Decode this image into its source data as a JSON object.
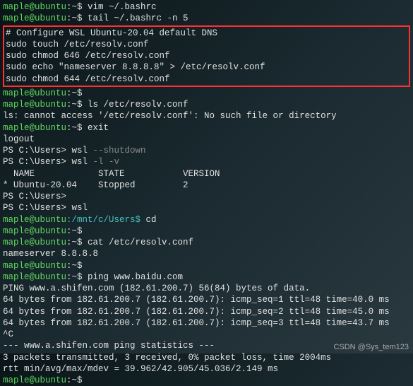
{
  "prompt_user": "maple@ubuntu",
  "prompt_home": ":~$ ",
  "prompt_mnt": ":/mnt/c/Users$ ",
  "ps_prompt": "PS C:\\Users> ",
  "cmds": {
    "vim": "vim ~/.bashrc",
    "tail": "tail ~/.bashrc -n 5",
    "ls_resolv": "ls /etc/resolv.conf",
    "exit": "exit",
    "wsl_shutdown": "wsl ",
    "wsl_shutdown_arg": "--shutdown",
    "wsl_list": "wsl ",
    "wsl_list_arg": "-l -v",
    "wsl": "wsl",
    "cd": "cd",
    "cat": "cat /etc/resolv.conf",
    "ping": "ping www.baidu.com"
  },
  "box": {
    "l1": "# Configure WSL Ubuntu-20.04 default DNS",
    "l2": "sudo touch /etc/resolv.conf",
    "l3": "sudo chmod 646 /etc/resolv.conf",
    "l4": "sudo echo \"nameserver 8.8.8.8\" > /etc/resolv.conf",
    "l5": "sudo chmod 644 /etc/resolv.conf"
  },
  "out": {
    "ls_err": "ls: cannot access '/etc/resolv.conf': No such file or directory",
    "logout": "logout",
    "wsl_hdr": "  NAME            STATE           VERSION",
    "wsl_row": "* Ubuntu-20.04    Stopped         2",
    "nameserver": "nameserver 8.8.8.8",
    "ping_hdr": "PING www.a.shifen.com (182.61.200.7) 56(84) bytes of data.",
    "ping1": "64 bytes from 182.61.200.7 (182.61.200.7): icmp_seq=1 ttl=48 time=40.0 ms",
    "ping2": "64 bytes from 182.61.200.7 (182.61.200.7): icmp_seq=2 ttl=48 time=45.0 ms",
    "ping3": "64 bytes from 182.61.200.7 (182.61.200.7): icmp_seq=3 ttl=48 time=43.7 ms",
    "ctrlc": "^C",
    "stats_hdr": "--- www.a.shifen.com ping statistics ---",
    "stats1": "3 packets transmitted, 3 received, 0% packet loss, time 2004ms",
    "stats2": "rtt min/avg/max/mdev = 39.962/42.905/45.036/2.149 ms"
  },
  "watermark": "CSDN @Sys_tem123"
}
